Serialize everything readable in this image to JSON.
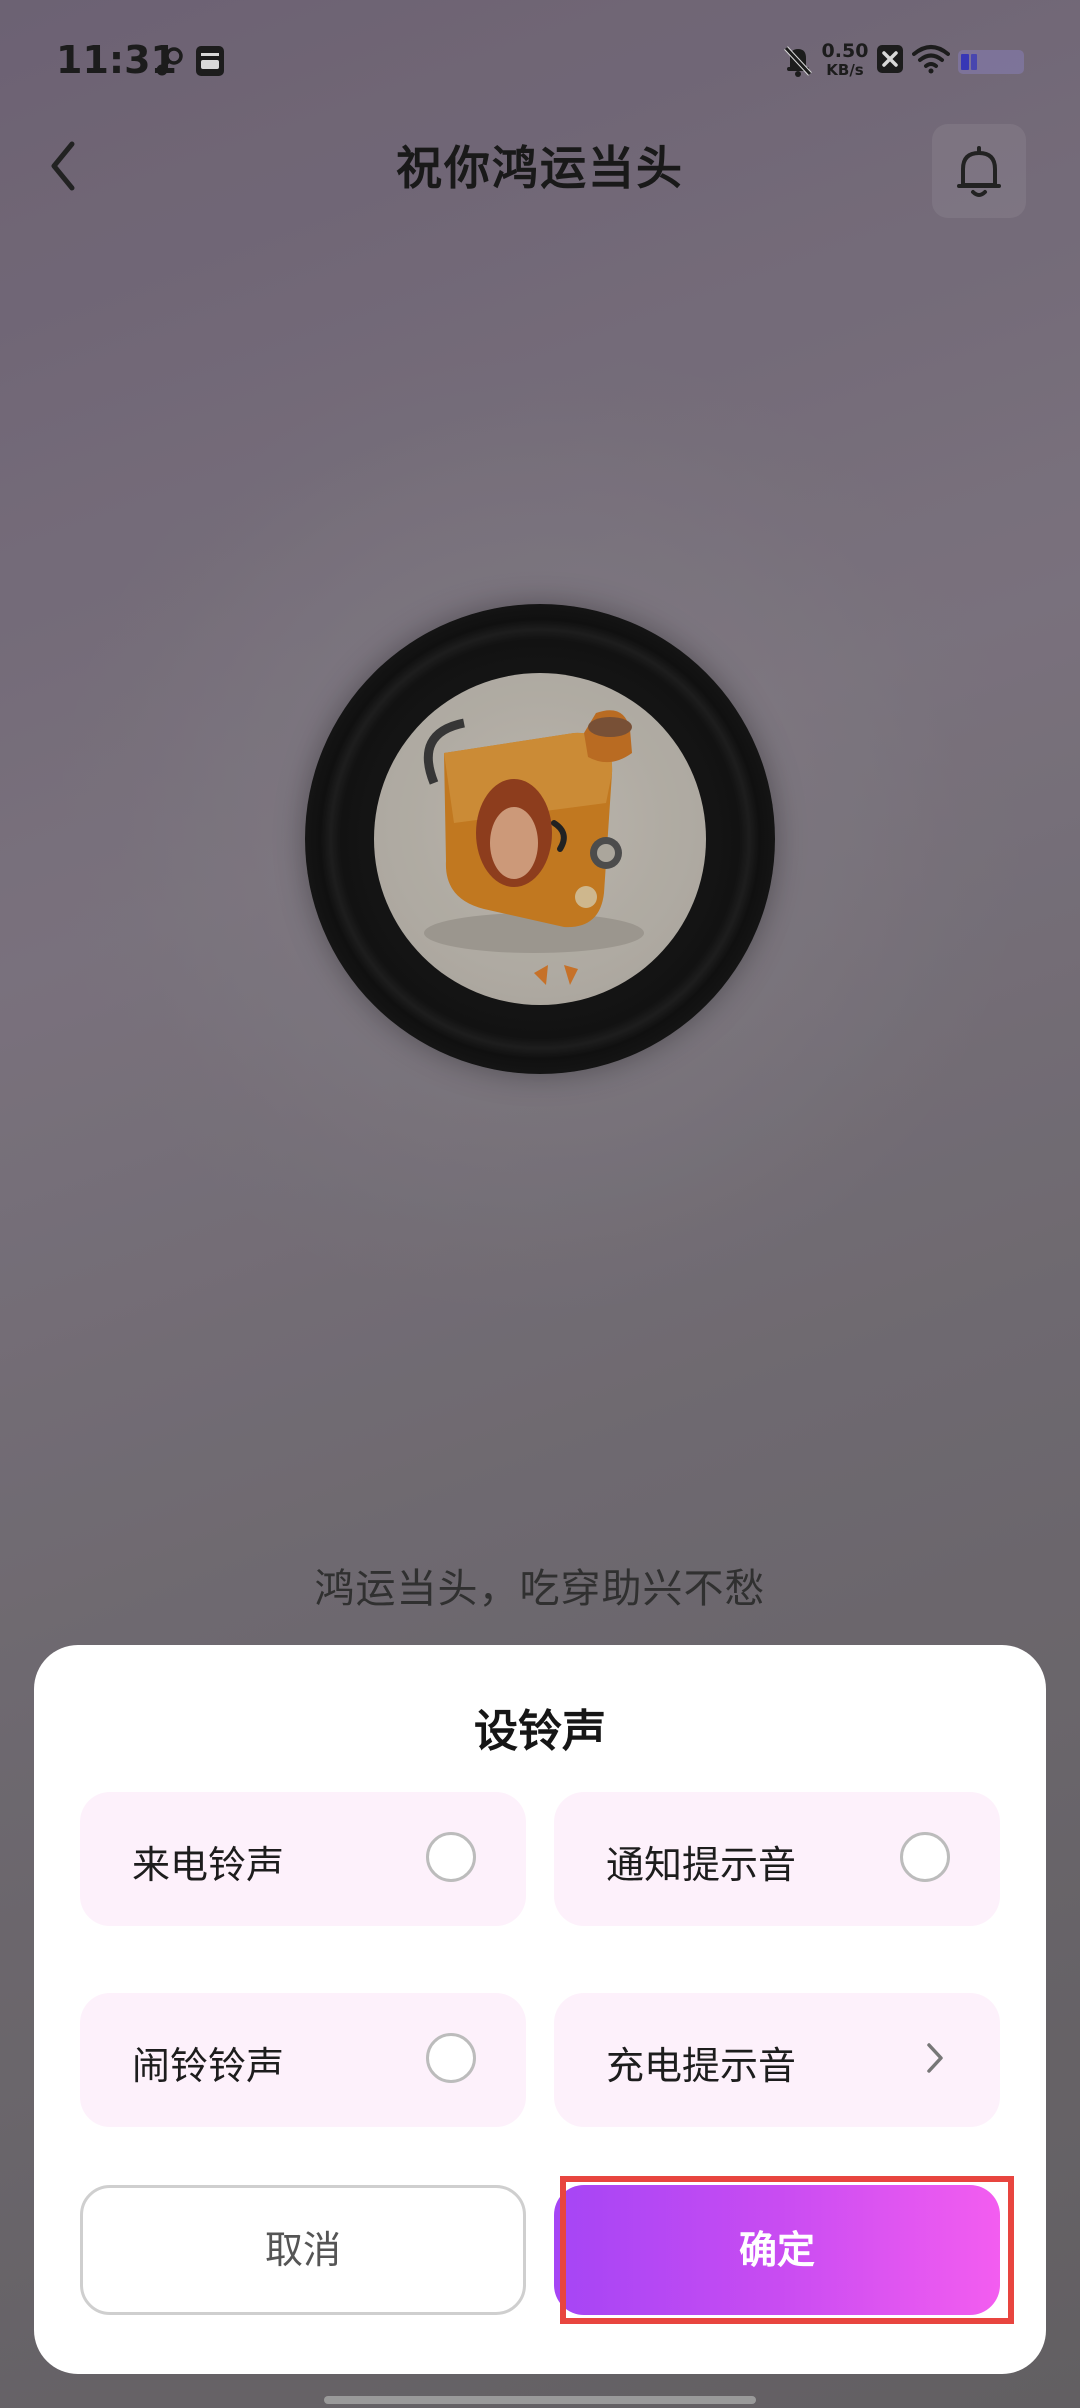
{
  "status_bar": {
    "time": "11:31",
    "speed_value": "0.50",
    "speed_unit": "KB/s",
    "icons": [
      "link-icon",
      "notes-icon",
      "mute-bell-icon",
      "x-app-icon",
      "wifi-icon",
      "battery-icon"
    ]
  },
  "header": {
    "title": "祝你鸿运当头",
    "back_icon": "chevron-left-icon",
    "bell_icon": "bell-icon"
  },
  "player": {
    "slogan": "鸿运当头，吃穿助兴不愁"
  },
  "sheet": {
    "title": "设铃声",
    "options": [
      {
        "label": "来电铃声",
        "control": "radio"
      },
      {
        "label": "通知提示音",
        "control": "radio"
      },
      {
        "label": "闹铃铃声",
        "control": "radio"
      },
      {
        "label": "充电提示音",
        "control": "chevron-right-icon"
      }
    ],
    "cancel_label": "取消",
    "confirm_label": "确定"
  },
  "colors": {
    "accent_start": "#a545f5",
    "accent_end": "#f35df0",
    "option_bg": "#fdf1fb",
    "highlight": "#e8453f"
  }
}
